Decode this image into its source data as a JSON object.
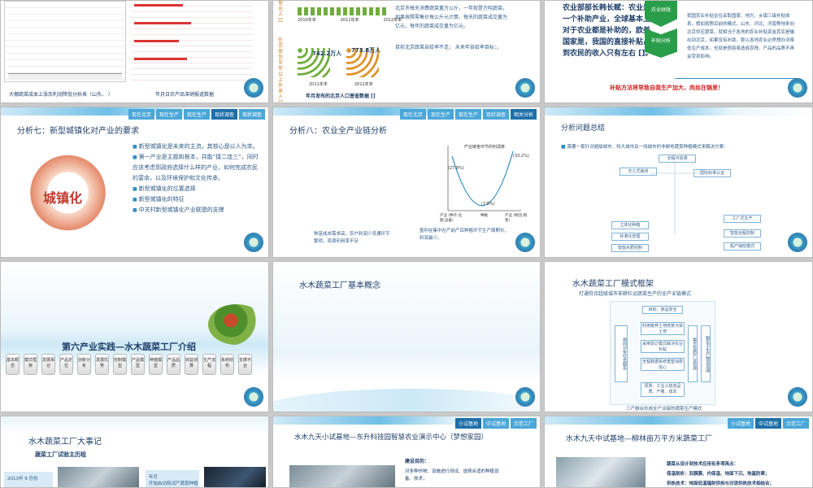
{
  "slide1": {
    "caption_left": "大棚蔬菜成本上涨及利润降低分析表（山东、 ）",
    "caption_right": "年月日农产品滞销报道数据"
  },
  "slide2": {
    "chart_labels": [
      "2011年末",
      "2012年末"
    ],
    "values": [
      "742.2万人",
      "773.8万人"
    ],
    "vertical_text": "在京居住半年以上外来人口",
    "vertical_text2": "常住人口",
    "bottom_caption": "年月发布的北京人口普查数据 []",
    "para1": "北京市每天消费蔬菜量万公斤，一年就是万吨蔬菜。如果按照零售价每公斤元计算，每天的蔬菜成交量为亿元，每年的蔬菜成交量为亿元。",
    "bullet1": "目前北京蔬菜自给率不足； 未来年自给率目标：。",
    "years": [
      "2010年末",
      "2011年末",
      "2012年末"
    ]
  },
  "slide3": {
    "quote": "农业部部长韩长赋：农业是一个补助产业，全球基本上对于农业都是补助的，欧美国家是，我国的直接补贴占到农民的收入只有左右 []。",
    "badge1": "农业财政",
    "badge2": "补贴分析",
    "body": "我国农业补贴往往采取国家、地方、乡镇三级补贴体系。假如按照目前的模式，山东、河北、河南等地来向北京供应蔬菜，就相当于各地的农业补贴资金其实是输出到北京，如果没有补助，那么各地农业必然想办法降低生产成本，也就是很容易造成农残、产品的品质不再会受到影响。",
    "red_line": "补贴方法将导致自我生产加大，肉丝在锅里！"
  },
  "slide4": {
    "tabs": [
      "现在北京",
      "现在生产",
      "现在生产",
      "现状调查",
      "现状调查"
    ],
    "title": "分析七：新型城镇化对产业的要求",
    "bullets": [
      "新型城镇化是未来的主流，其核心是以人为本。",
      "第一产业是主题和根本，并能“接二连三”，同时应该考虑到政府选择什么样的产业，如何完成农民的富余，以及环境保护和文化传承。",
      "新型城镇化的位置选择",
      "新型城镇化的特征",
      "中关村新型城镇化产业联盟的支撑"
    ],
    "logo_text": "城镇化"
  },
  "slide5": {
    "tabs": [
      "现在北京",
      "现在生产",
      "现在生产",
      "现状调查",
      "相关分析"
    ],
    "title": "分析八：农业全产业链分析",
    "chart_title": "产业链各环节的利润率",
    "curve_labels": [
      "(33.2%)",
      "(27.8%)",
      "(7.6%)"
    ],
    "axis": [
      "产业\n(种子,化肥,设备)",
      "种植",
      "产业\n(物流,销售)"
    ],
    "left_note": "种苗成本需求高，农户利润少流通环节繁琐，资源利用率不足",
    "right_note": "盈利在集中在产前产后种植环节生产周期长，利润最少。"
  },
  "slide6": {
    "title": "分析问题总结",
    "bullet": "需要一套针对超级城市、特大城市及一线城市的非耕地蔬菜种植模式来解决方案：",
    "boxes": [
      "全程可追溯",
      "无土式栽培",
      "国际标准认证",
      "立体化种植",
      "标准化管理",
      "智能水肥控制",
      "工厂式生产",
      "智能远程控制",
      "瓶产抽检模式"
    ]
  },
  "slide7": {
    "title": "第六产业实践—水木蔬菜工厂介绍",
    "buttons": [
      "基本概念",
      "模式框架",
      "发展事记",
      "产品定位",
      "创新分析",
      "发展优势",
      "控制模型",
      "产品模型",
      "种植模型",
      "产品品质",
      "效益测算",
      "生产流程",
      "系统结构",
      "支撑平台"
    ]
  },
  "slide8": {
    "title": "水木蔬菜工厂基本概念"
  },
  "slide9": {
    "title": "水木蔬菜工厂模式框架",
    "subtitle": "打通符合超级城市非耕栏运蔬菜生产的全产业链模式",
    "goal": "目标：食品安全",
    "center1": "利用废弃土地修复污染土地",
    "center2": "采用现订模式解决农业补贴",
    "center3": "全程数据系统重塑消费信心",
    "principle": "原则：工业三稳态品质、产量、成本",
    "left_box": "面向对象社会服务",
    "right_box": "整合优质产业资源",
    "right_box2": "服务于生产物流流通",
    "bottom": "三产融合形成全产业链的蔬菜生产模式"
  },
  "slide10": {
    "title": "水木蔬菜工厂大事记",
    "subtitle": "蔬菜工厂试验主历程",
    "item1": "2013年 9 月份",
    "item2": "年月",
    "item2_text": "开始启动和试产蔬菜种植产"
  },
  "slide11": {
    "tabs": [
      "小试基地",
      "中试基地",
      "示范工厂"
    ],
    "title": "水木九天小试基地—东升科技园智慧农业演示中心（梦想家园）",
    "goal_label": "建设目的：",
    "goal_text": "对多种作物、设施进行测试、选择合适的种植设备、技术；"
  },
  "slide12": {
    "tabs": [
      "小试基地",
      "中试基地",
      "示范工厂"
    ],
    "title": "水木九天中试基地—柳林亩万平方米蔬菜工厂",
    "line1": "蔬菜从设计到技术应用有多项亮点：",
    "line2": "保温剖析：双膜膜、内保温、地面下沉、地基防寒；",
    "line3": "供热技术：地面低温辐射供热与对流供热技术相结合；"
  },
  "colors": {
    "accent": "#2d8ec6",
    "title": "#1f3f6a",
    "red": "#d22020",
    "green": "#2a9d4a"
  }
}
